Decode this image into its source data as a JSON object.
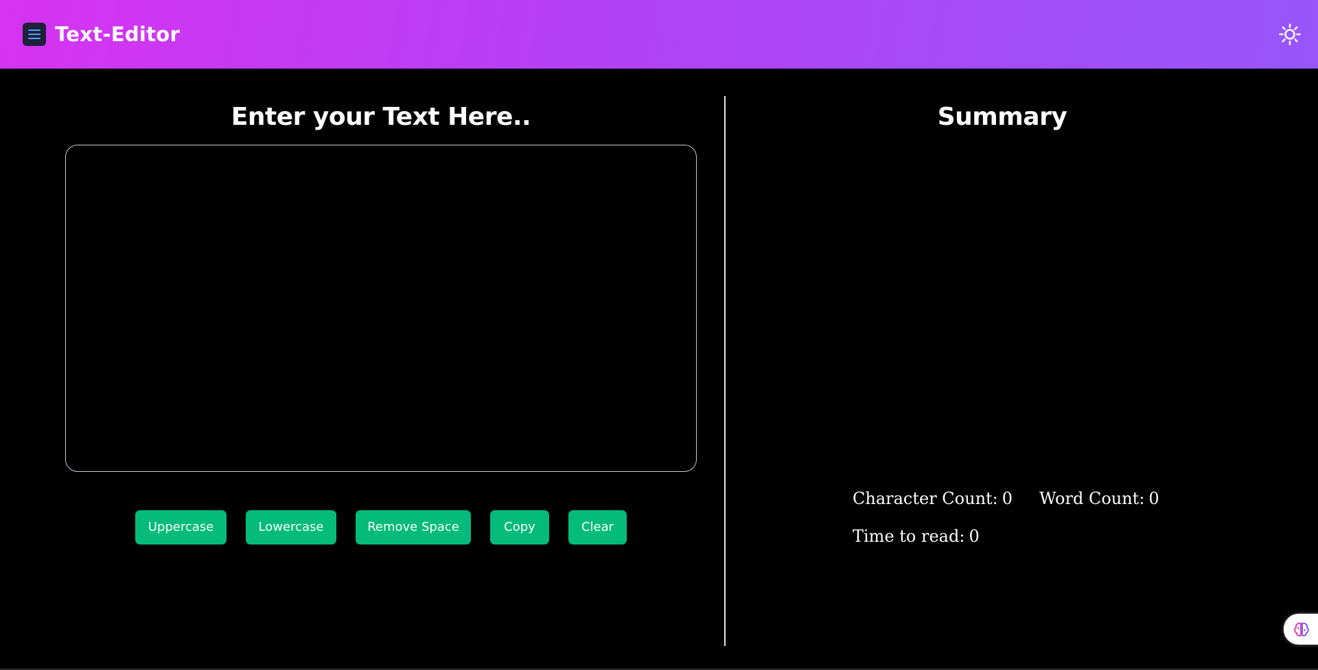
{
  "navbar": {
    "brand": "Text-Editor",
    "menu_icon": "hamburger-menu-icon",
    "theme_icon": "sun-icon"
  },
  "editor": {
    "title": "Enter your Text Here..",
    "value": "",
    "placeholder": ""
  },
  "actions": [
    {
      "label": "Uppercase"
    },
    {
      "label": "Lowercase"
    },
    {
      "label": "Remove Space"
    },
    {
      "label": "Copy"
    },
    {
      "label": "Clear"
    }
  ],
  "summary": {
    "title": "Summary",
    "character_count_label": "Character Count:",
    "character_count": "0",
    "word_count_label": "Word Count:",
    "word_count": "0",
    "time_to_read_label": "Time to read:",
    "time_to_read": "0"
  },
  "colors": {
    "navbar_gradient_start": "#d633f2",
    "navbar_gradient_end": "#9755fb",
    "button_green": "#04bb7c",
    "background": "#000000"
  },
  "floating_widget": {
    "icon": "brain-icon"
  }
}
